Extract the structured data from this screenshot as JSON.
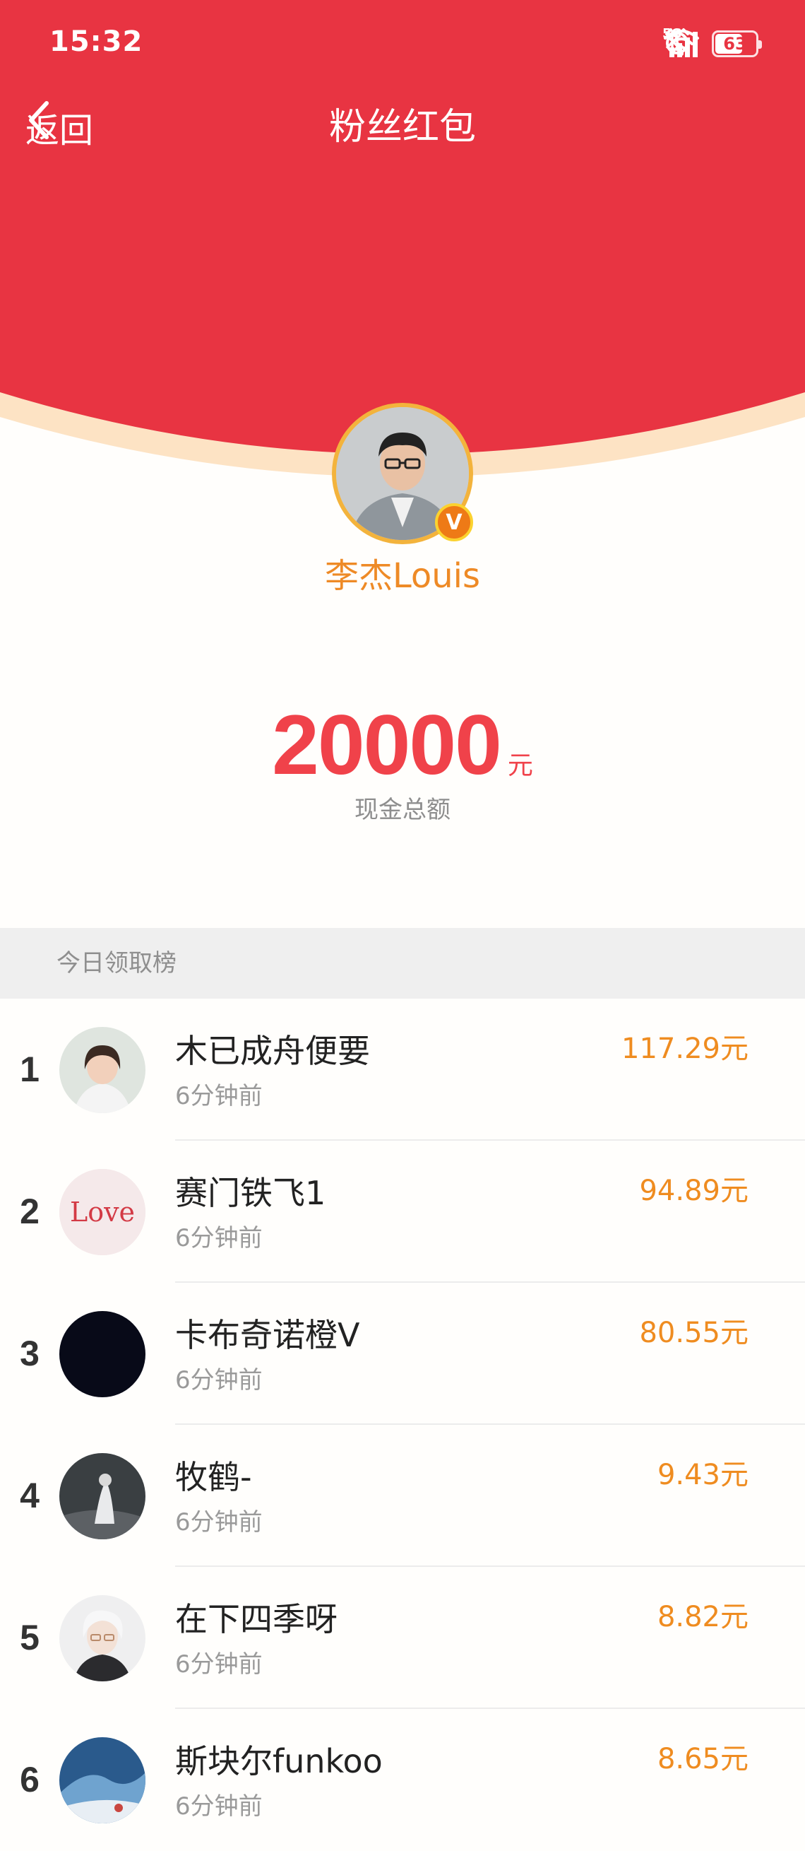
{
  "status_bar": {
    "time": "15:32",
    "battery": "63",
    "network": "5G",
    "icons": [
      "alarm-icon",
      "bluetooth-icon",
      "wifi-icon",
      "signal-icon",
      "battery-icon"
    ]
  },
  "nav": {
    "back_label": "返回",
    "title": "粉丝红包"
  },
  "host": {
    "name": "李杰Louis",
    "badge": "V"
  },
  "summary": {
    "amount": "20000",
    "unit": "元",
    "label": "现金总额"
  },
  "ranking": {
    "title": "今日领取榜",
    "items": [
      {
        "rank": "1",
        "name": "木已成舟便要",
        "time": "6分钟前",
        "amount": "117.29元"
      },
      {
        "rank": "2",
        "name": "赛门铁飞1",
        "time": "6分钟前",
        "amount": "94.89元",
        "avatar_text": "Love"
      },
      {
        "rank": "3",
        "name": "卡布奇诺橙V",
        "time": "6分钟前",
        "amount": "80.55元"
      },
      {
        "rank": "4",
        "name": "牧鹤-",
        "time": "6分钟前",
        "amount": "9.43元"
      },
      {
        "rank": "5",
        "name": "在下四季呀",
        "time": "6分钟前",
        "amount": "8.82元"
      },
      {
        "rank": "6",
        "name": "斯块尔funkoo",
        "time": "6分钟前",
        "amount": "8.65元"
      }
    ]
  },
  "colors": {
    "header_red": "#e83442",
    "accent_orange": "#ee8a26",
    "amount_red": "#f0424a"
  }
}
